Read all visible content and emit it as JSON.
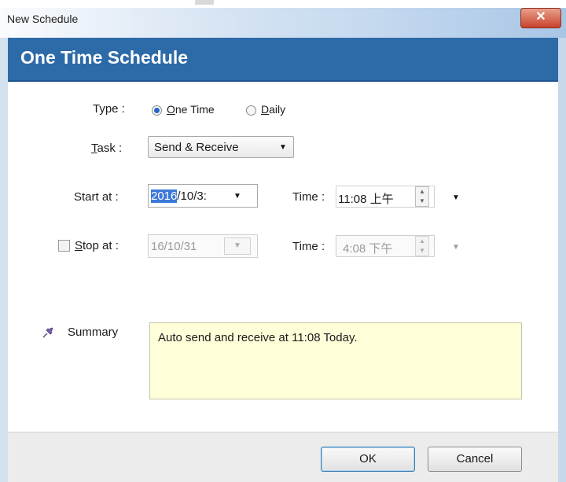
{
  "window": {
    "title": "New Schedule",
    "close_glyph": "✕"
  },
  "header": {
    "title": "One Time Schedule"
  },
  "type_row": {
    "label": "Type :",
    "options": [
      {
        "label_first": "O",
        "label_rest": "ne Time",
        "selected": true
      },
      {
        "label_first": "D",
        "label_rest": "aily",
        "selected": false
      }
    ]
  },
  "task_row": {
    "label_first": "T",
    "label_rest": "ask :",
    "value": "Send & Receive"
  },
  "start_row": {
    "label": "Start at :",
    "date_highlight": "2016",
    "date_rest": "/10/3:",
    "time_label": "Time :",
    "time_value": "11:08 上午"
  },
  "stop_row": {
    "checked": false,
    "label_first": "S",
    "label_rest": "top at :",
    "date_value": "16/10/31",
    "time_label": "Time :",
    "time_value": "4:08 下午"
  },
  "summary": {
    "label": "Summary",
    "text": "Auto send and receive at 11:08 Today."
  },
  "buttons": {
    "ok": "OK",
    "cancel": "Cancel"
  },
  "icons": {
    "pin": "pin-icon",
    "caret": "▼",
    "spin_up": "▲",
    "spin_down": "▼"
  },
  "colors": {
    "header": "#2d6aa8",
    "summary_bg": "#fefed9",
    "close": "#c8422b"
  }
}
